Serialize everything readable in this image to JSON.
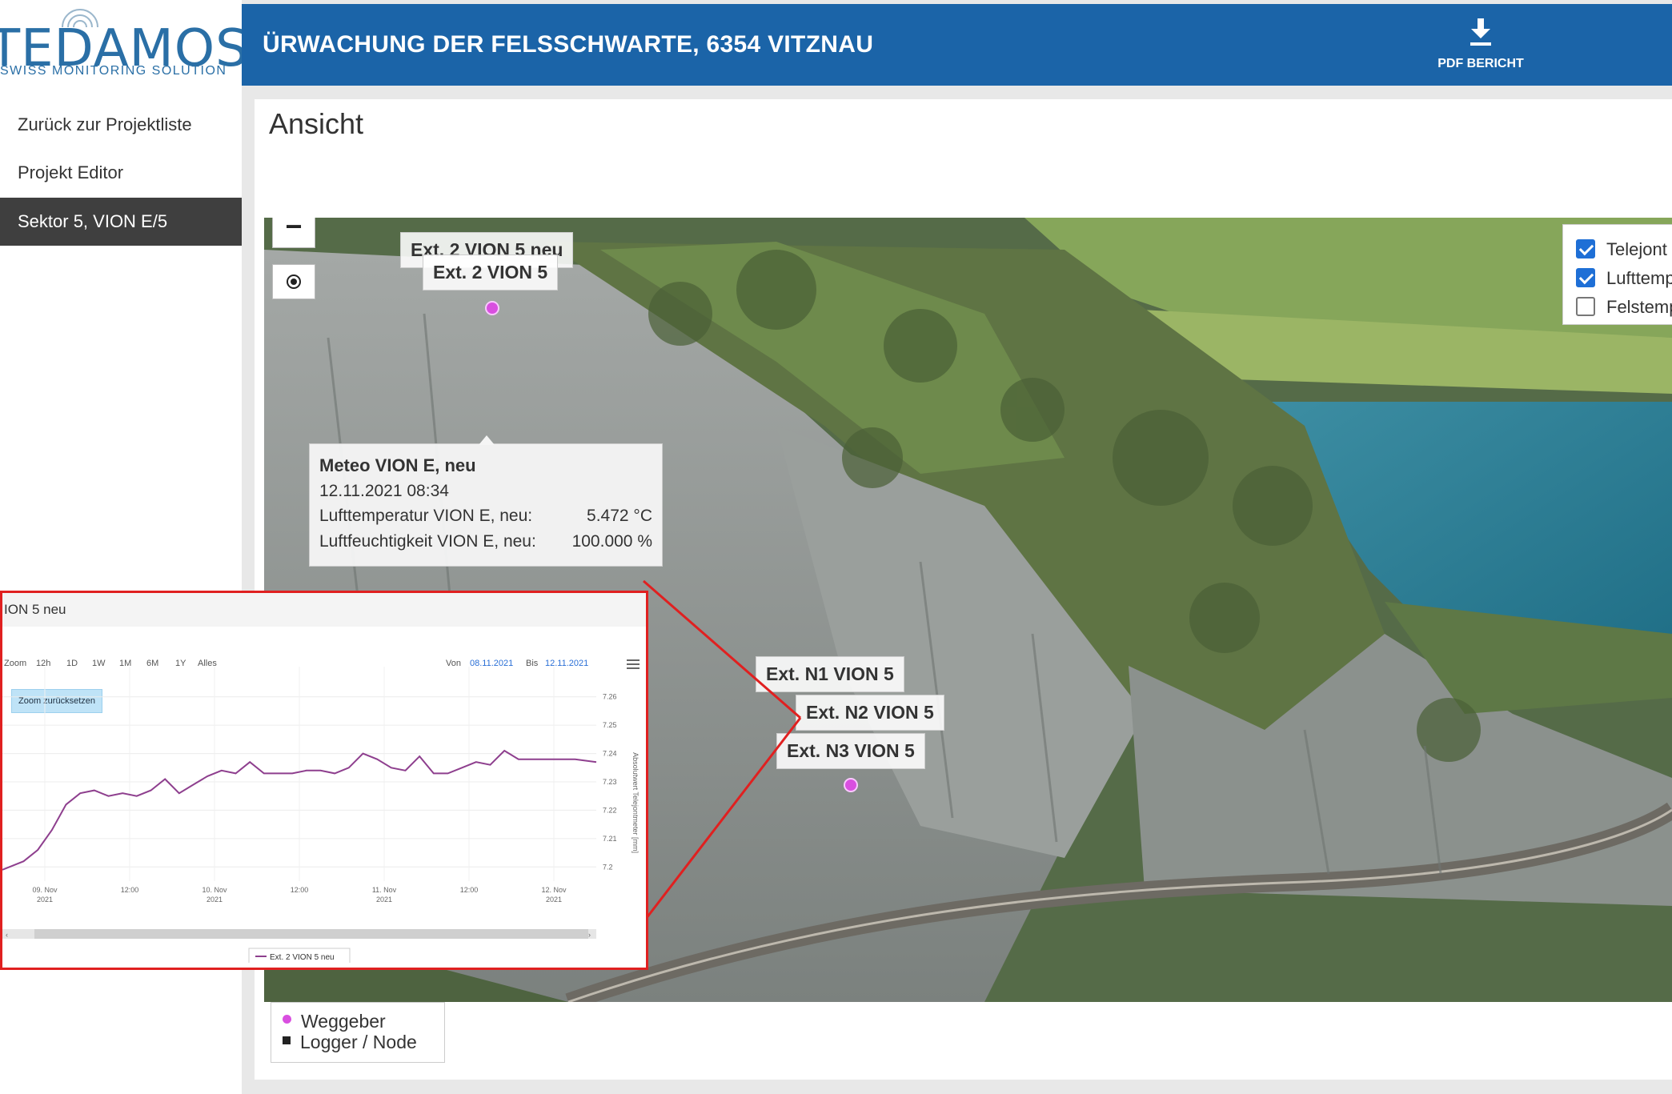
{
  "logo": {
    "wordmark": "TEDAMOS",
    "tagline": "SWISS MONITORING SOLUTION"
  },
  "header": {
    "title": "ÜRWACHUNG DER FELSSCHWARTE, 6354 VITZNAU",
    "pdf_label": "PDF BERICHT"
  },
  "sidebar": {
    "items": [
      {
        "label": "Zurück zur Projektliste"
      },
      {
        "label": "Projekt Editor"
      },
      {
        "label": "Sektor 5, VION E/5",
        "active": true
      }
    ]
  },
  "main": {
    "heading": "Ansicht"
  },
  "map": {
    "zoom_in": "+",
    "zoom_out": "−",
    "locate_icon": "locate-icon",
    "labels": {
      "ext2_neu": "Ext. 2 VION 5 neu",
      "ext2": "Ext. 2 VION 5",
      "n1": "Ext. N1 VION 5",
      "n2": "Ext. N2 VION 5",
      "n3": "Ext. N3 VION 5"
    },
    "tooltip": {
      "title": "Meteo VION E, neu",
      "date": "12.11.2021 08:34",
      "rows": [
        {
          "label": "Lufttemperatur VION E, neu:",
          "value": "5.472 °C"
        },
        {
          "label": "Luftfeuchtigkeit VION E, neu:",
          "value": "100.000 %"
        }
      ]
    },
    "layers": [
      {
        "label": "Telejont",
        "checked": true
      },
      {
        "label": "Lufttemp",
        "checked": true
      },
      {
        "label": "Felstemp",
        "checked": false
      }
    ],
    "legend": [
      {
        "label": "Weggeber",
        "symbol": "dot",
        "color": "#d94fe0"
      },
      {
        "label": "Logger / Node",
        "symbol": "square",
        "color": "#222222"
      }
    ]
  },
  "chart_panel": {
    "title": "ION 5 neu",
    "zoom_label": "Zoom",
    "zoom_buttons": [
      "12h",
      "1D",
      "1W",
      "1M",
      "6M",
      "1Y",
      "Alles"
    ],
    "von_label": "Von",
    "von_value": "08.11.2021",
    "bis_label": "Bis",
    "bis_value": "12.11.2021",
    "reset_label": "Zoom zurücksetzen",
    "menu_icon": "hamburger-menu-icon"
  },
  "chart_data": {
    "type": "line",
    "title": "",
    "ylabel": "Absolutwert Telejontmeter [mm]",
    "ylim": [
      7.195,
      7.265
    ],
    "yticks": [
      "7.26",
      "7.25",
      "7.24",
      "7.23",
      "7.22",
      "7.21",
      "7.2"
    ],
    "xlim": [
      0,
      84
    ],
    "xticks": [
      {
        "x": 6,
        "line1": "09. Nov",
        "line2": "2021"
      },
      {
        "x": 18,
        "line1": "12:00",
        "line2": ""
      },
      {
        "x": 30,
        "line1": "10. Nov",
        "line2": "2021"
      },
      {
        "x": 42,
        "line1": "12:00",
        "line2": ""
      },
      {
        "x": 54,
        "line1": "11. Nov",
        "line2": "2021"
      },
      {
        "x": 66,
        "line1": "12:00",
        "line2": ""
      },
      {
        "x": 78,
        "line1": "12. Nov",
        "line2": "2021"
      }
    ],
    "series": [
      {
        "name": "Ext. 2 VION 5 neu",
        "color": "#8e3f8e",
        "x": [
          0,
          3,
          5,
          7,
          9,
          11,
          13,
          15,
          17,
          19,
          21,
          23,
          25,
          27,
          29,
          31,
          33,
          35,
          37,
          39,
          41,
          43,
          45,
          47,
          49,
          51,
          53,
          55,
          57,
          59,
          61,
          63,
          65,
          67,
          69,
          71,
          73,
          75,
          77,
          79,
          81,
          84
        ],
        "y": [
          7.199,
          7.202,
          7.206,
          7.213,
          7.222,
          7.226,
          7.227,
          7.225,
          7.226,
          7.225,
          7.227,
          7.231,
          7.226,
          7.229,
          7.232,
          7.234,
          7.233,
          7.237,
          7.233,
          7.233,
          7.233,
          7.234,
          7.234,
          7.233,
          7.235,
          7.24,
          7.238,
          7.235,
          7.234,
          7.239,
          7.233,
          7.233,
          7.235,
          7.237,
          7.236,
          7.241,
          7.238,
          7.238,
          7.238,
          7.238,
          7.238,
          7.237
        ]
      }
    ],
    "legend": "bottom-center"
  }
}
